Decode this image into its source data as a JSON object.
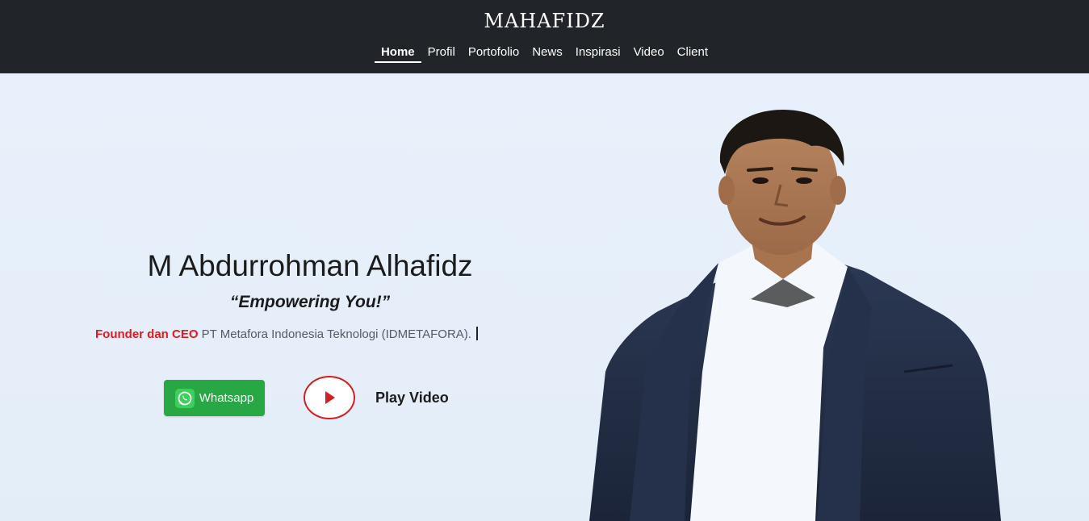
{
  "header": {
    "brand": "MAHAFIDZ",
    "nav": [
      {
        "label": "Home",
        "active": true
      },
      {
        "label": "Profil",
        "active": false
      },
      {
        "label": "Portofolio",
        "active": false
      },
      {
        "label": "News",
        "active": false
      },
      {
        "label": "Inspirasi",
        "active": false
      },
      {
        "label": "Video",
        "active": false
      },
      {
        "label": "Client",
        "active": false
      }
    ]
  },
  "hero": {
    "name": "M Abdurrohman Alhafidz",
    "tagline": "“Empowering You!”",
    "role_highlight": "Founder dan CEO",
    "role_text": " PT Metafora Indonesia Teknologi (IDMETAFORA).",
    "whatsapp_label": "Whatsapp",
    "play_label": "Play Video",
    "portrait_icon": "person-photo"
  },
  "colors": {
    "header_bg": "#212428",
    "hero_bg": "#e8f1fb",
    "accent_red": "#e3191e",
    "whatsapp_green": "#27a844"
  }
}
